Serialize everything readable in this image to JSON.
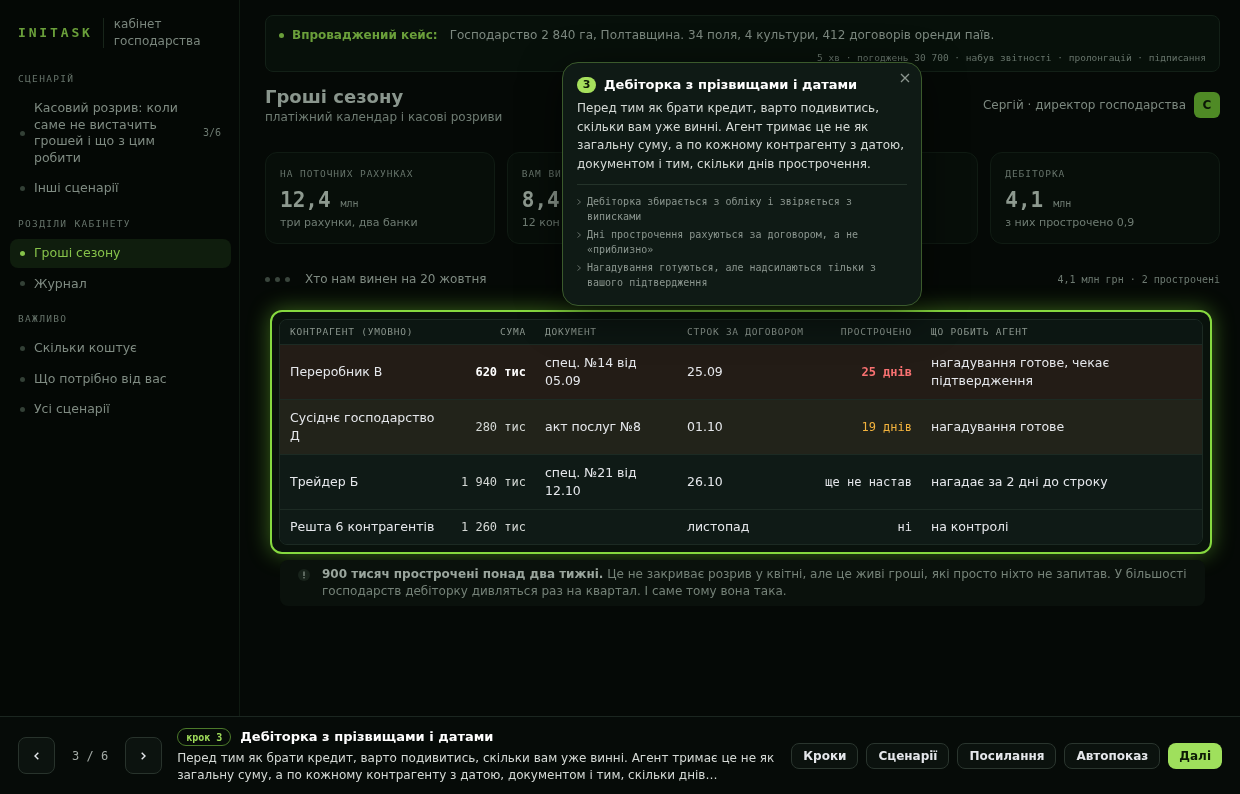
{
  "sidebar": {
    "logo": "INITASK",
    "logo_caption": "кабінет господарства",
    "sections": [
      {
        "title": "СЦЕНАРІЙ",
        "items": [
          {
            "label": "Касовий розрив: коли саме не вистачить грошей і що з цим робити",
            "count": "3/6",
            "selected": false
          },
          {
            "label": "Інші сценарії",
            "selected": false
          }
        ]
      },
      {
        "title": "РОЗДІЛИ КАБІНЕТУ",
        "items": [
          {
            "label": "Гроші сезону",
            "selected": true
          },
          {
            "label": "Журнал",
            "selected": false
          }
        ]
      },
      {
        "title": "ВАЖЛИВО",
        "items": [
          {
            "label": "Скільки коштує",
            "selected": false
          },
          {
            "label": "Що потрібно від вас",
            "selected": false
          },
          {
            "label": "Усі сценарії",
            "selected": false
          }
        ]
      }
    ]
  },
  "banner": {
    "label": "Впроваджений кейс:",
    "text": "Господарство 2 840 га, Полтавщина. 34 поля, 4 культури, 412 договорів оренди паїв.",
    "meta": "5 хв · погоджень 30 700 · набув звітності · пролонгацій · підписання"
  },
  "header": {
    "title": "Гроші сезону",
    "subtitle": "платіжний календар і касові розриви",
    "user": "Сергій · директор господарства",
    "avatar": "С"
  },
  "stats": [
    {
      "label": "НА ПОТОЧНИХ РАХУНКАХ",
      "value": "12,4",
      "unit": "млн",
      "note": "три рахунки, два банки"
    },
    {
      "label": "ВАМ ВИ",
      "value": "8,4",
      "note": "12 кон"
    },
    {
      "label": "ДЕБІТОРКА",
      "value": "4,1",
      "unit": "млн",
      "note": "з них прострочено 0,9"
    }
  ],
  "section": {
    "title": "Хто нам винен на 20 жовтня",
    "summary": "4,1 млн грн · 2 прострочені"
  },
  "table": {
    "columns": [
      "КОНТРАГЕНТ (УМОВНО)",
      "СУМА",
      "ДОКУМЕНТ",
      "СТРОК ЗА ДОГОВОРОМ",
      "ПРОСТРОЧЕНО",
      "ЩО РОБИТЬ АГЕНТ"
    ],
    "rows": [
      {
        "counterparty": "Переробник В",
        "amount": "620 тис",
        "amount_bold": true,
        "document": "спец. №14 від 05.09",
        "due": "25.09",
        "overdue": "25 днів",
        "kind": "critical",
        "action": "нагадування готове, чекає підтвердження"
      },
      {
        "counterparty": "Сусіднє господарство Д",
        "amount": "280 тис",
        "amount_bold": false,
        "document": "акт послуг №8",
        "due": "01.10",
        "overdue": "19 днів",
        "kind": "warning",
        "action": "нагадування готове"
      },
      {
        "counterparty": "Трейдер Б",
        "amount": "1 940 тис",
        "amount_bold": false,
        "document": "спец. №21 від 12.10",
        "due": "26.10",
        "overdue": "ще не настав",
        "kind": "normal",
        "action": "нагадає за 2 дні до строку"
      },
      {
        "counterparty": "Решта 6 контрагентів",
        "amount": "1 260 тис",
        "amount_bold": false,
        "due": "листопад",
        "overdue": "ні",
        "kind": "normal",
        "action": "на контролі"
      }
    ]
  },
  "note": {
    "text": "**900 тисяч прострочені понад два тижні.** Це не закриває розрив у квітні, але це живі гроші, які просто ніхто не запитав. У більшості господарств дебіторку дивляться раз на квартал. І саме тому вона така."
  },
  "popover": {
    "step": "3",
    "title": "Дебіторка з прізвищами і датами",
    "text": "Перед тим як брати кредит, варто подивитись, скільки вам уже винні. Агент тримає це не як загальну суму, а по кожному контрагенту з датою, документом і тим, скільки днів прострочення.",
    "points": [
      "Дебіторка збирається з обліку і звіряється з виписками",
      "Дні прострочення рахуються за договором, а не «приблизно»",
      "Нагадування готуються, але надсилаються тільки з вашого підтвердження"
    ]
  },
  "tour_bar": {
    "counter": "3 / 6",
    "badge": "крок 3",
    "title": "Дебіторка з прізвищами і датами",
    "text": "Перед тим як брати кредит, варто подивитись, скільки вам уже винні. Агент тримає це не як загальну суму, а по кожному контрагенту з датою, документом і тим, скільки днів…",
    "buttons": [
      {
        "label": "Кроки",
        "primary": false
      },
      {
        "label": "Сценарії",
        "primary": false
      },
      {
        "label": "Посилання",
        "primary": false
      },
      {
        "label": "Автопоказ",
        "primary": false
      },
      {
        "label": "Далі",
        "primary": true
      }
    ]
  }
}
